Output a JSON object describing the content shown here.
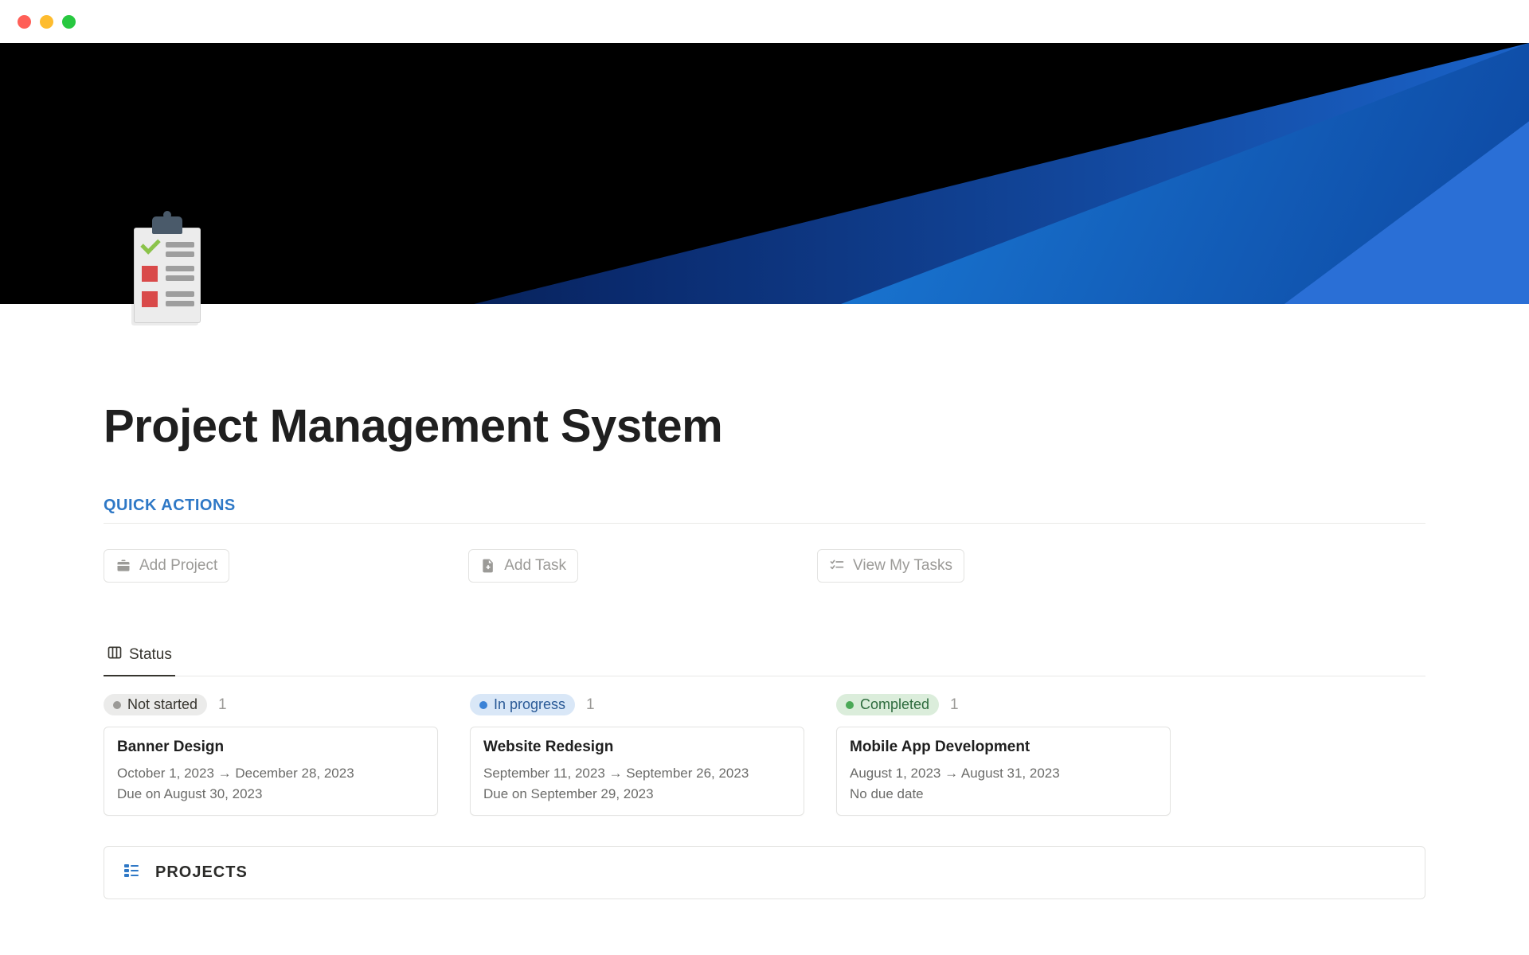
{
  "page": {
    "title": "Project Management System"
  },
  "quick_actions": {
    "heading": "QUICK ACTIONS",
    "add_project": "Add Project",
    "add_task": "Add Task",
    "view_tasks": "View My Tasks"
  },
  "tabs": {
    "status": "Status"
  },
  "board": {
    "columns": [
      {
        "label": "Not started",
        "count": "1",
        "pill_class": "pill-gray",
        "card": {
          "title": "Banner Design",
          "range": "October 1, 2023 → December 28, 2023",
          "due": "Due on August 30, 2023"
        }
      },
      {
        "label": "In progress",
        "count": "1",
        "pill_class": "pill-blue",
        "card": {
          "title": "Website Redesign",
          "range": "September 11, 2023 → September 26, 2023",
          "due": "Due on September 29, 2023"
        }
      },
      {
        "label": "Completed",
        "count": "1",
        "pill_class": "pill-green",
        "card": {
          "title": "Mobile App Development",
          "range": "August 1, 2023 → August 31, 2023",
          "due": "No due date"
        }
      }
    ]
  },
  "projects": {
    "heading": "PROJECTS"
  }
}
